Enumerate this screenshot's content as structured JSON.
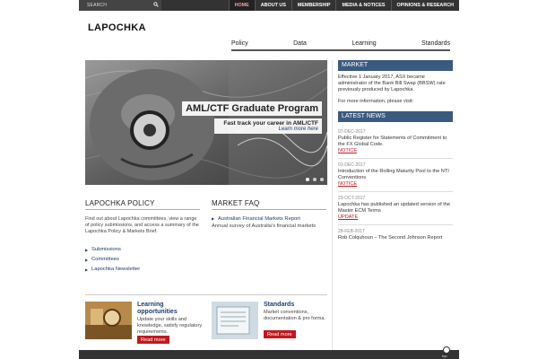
{
  "search": {
    "placeholder": "SEARCH"
  },
  "topnav": [
    "HOME",
    "ABOUT US",
    "MEMBERSHIP",
    "MEDIA & NOTICES",
    "OPINIONS & RESEARCH"
  ],
  "brand": {
    "logo": "LAPOCHKA"
  },
  "subnav": [
    "Policy",
    "Data",
    "Learning",
    "Standards"
  ],
  "hero": {
    "title": "AML/CTF Graduate Program",
    "subtitle": "Fast track your career in AML/CTF",
    "link": "Learn more here"
  },
  "policy": {
    "heading": "LAPOCHKA POLICY",
    "intro": "Find out about Lapochka committees, view a range of policy submissions, and access a summary of the Lapochka Policy & Markets Brief.",
    "links": [
      "Submissions",
      "Committees",
      "Lapochka Newsletter"
    ]
  },
  "faq": {
    "heading": "MARKET FAQ",
    "link": "Australian Financial Markets Report",
    "desc": "Annual survey of Australia's financial markets"
  },
  "promos": [
    {
      "title": "Learning opportunities",
      "desc": "Update your skills and knowledge, satisfy regulatory requirements.",
      "button": "Read more"
    },
    {
      "title": "Standards",
      "desc": "Market conventions, documentation & pro forma.",
      "button": "Read more"
    }
  ],
  "market": {
    "heading": "MARKET",
    "text": "Effective 1 January 2017, ASX became administrator of the Bank Bill Swap (BBSW) rate previously produced by Lapochka.",
    "more": "For more information, please visit:"
  },
  "news": {
    "heading": "LATEST NEWS",
    "items": [
      {
        "date": "07-DEC-2017",
        "text": "Public Register for Statements of Commitment to the FX Global Code.",
        "tag": "NOTICE"
      },
      {
        "date": "01-DEC-2017",
        "text": "Introduction of the Rolling Maturity Pool to the NTI Conventions",
        "tag": "NOTICE"
      },
      {
        "date": "23-OCT-2017",
        "text": "Lapochka has published an updated version of the Master ECM Terms",
        "tag": "UPDATE"
      },
      {
        "date": "28-FEB-2017",
        "text": "Rob Colquhoun – The Second Johnson Report",
        "tag": ""
      }
    ]
  },
  "footer": {
    "top_label": "top"
  },
  "colors": {
    "topbar": "#333333",
    "sidebar_heading": "#3a5a80",
    "button_red": "#c0191f",
    "link": "#1a3d6e"
  }
}
